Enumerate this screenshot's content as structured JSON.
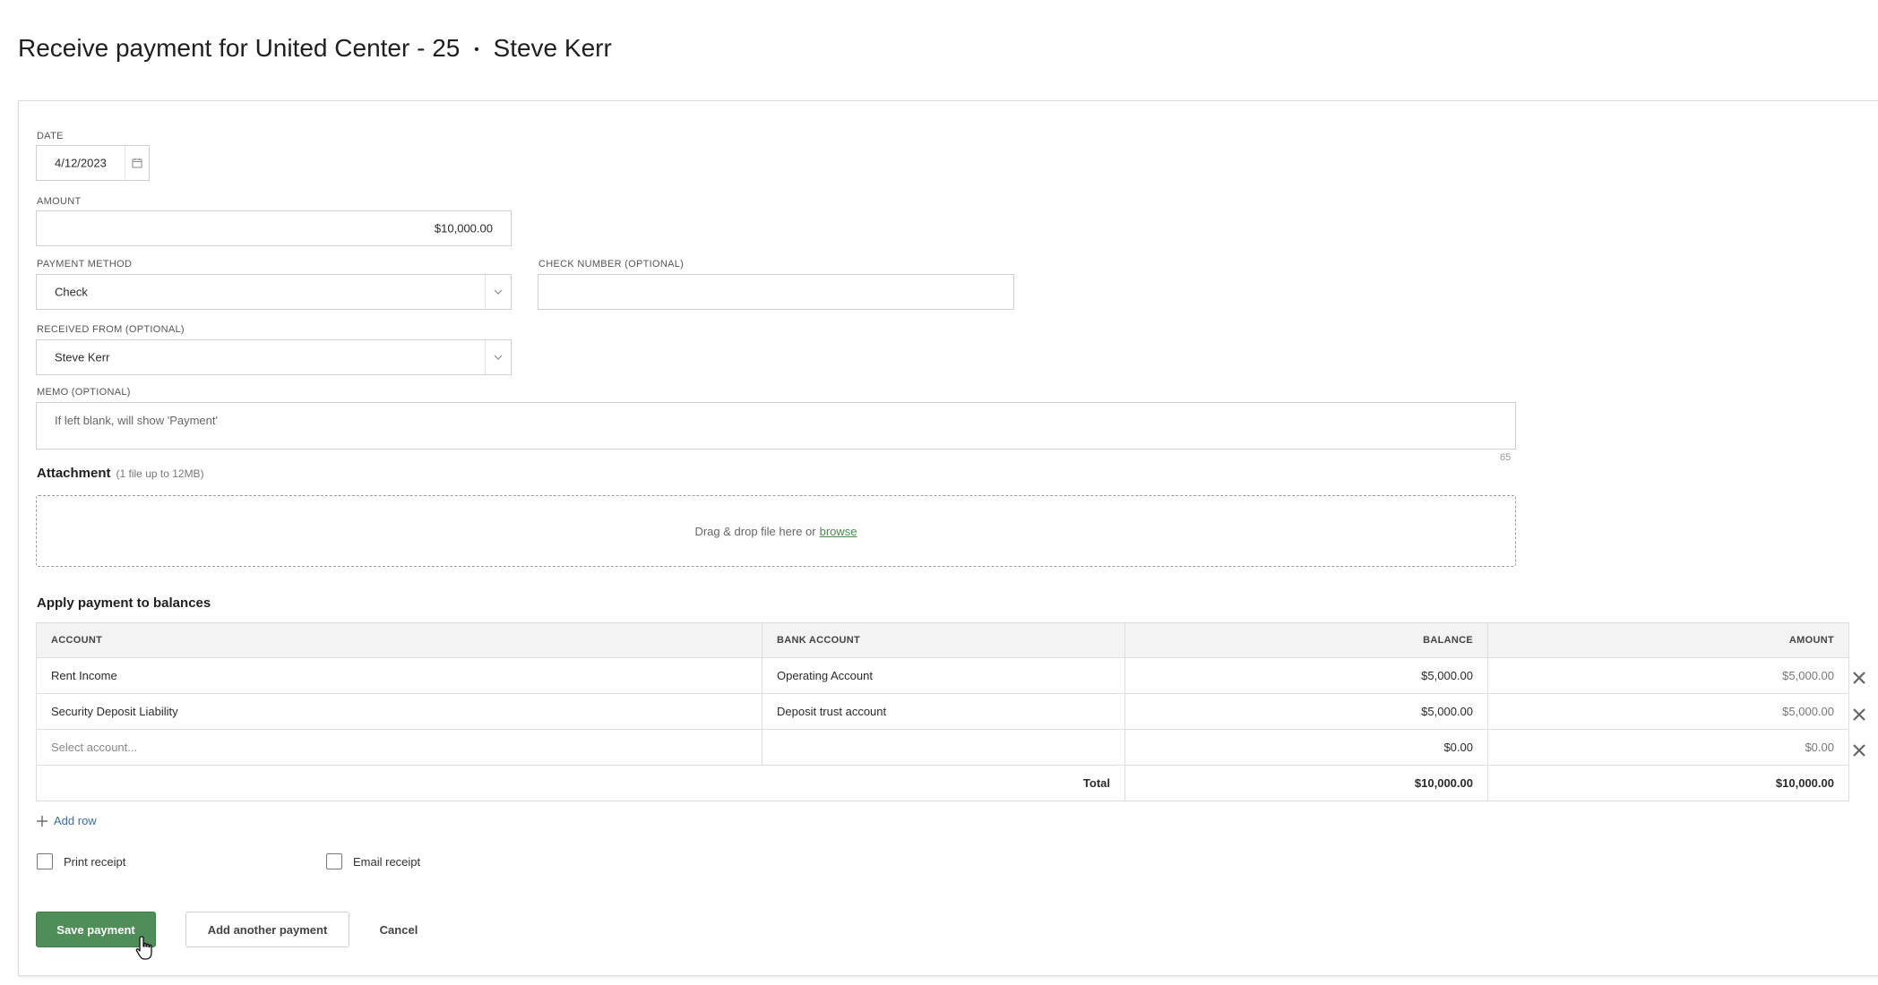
{
  "page": {
    "title": "Receive payment for United Center - 25",
    "separator": "•",
    "tenant": "Steve Kerr"
  },
  "form": {
    "date": {
      "label": "DATE",
      "value": "4/12/2023"
    },
    "amount": {
      "label": "AMOUNT",
      "value": "$10,000.00"
    },
    "payment_method": {
      "label": "PAYMENT METHOD",
      "value": "Check"
    },
    "check_number": {
      "label": "CHECK NUMBER (OPTIONAL)",
      "value": ""
    },
    "received_from": {
      "label": "RECEIVED FROM (OPTIONAL)",
      "value": "Steve Kerr"
    },
    "memo": {
      "label": "MEMO (OPTIONAL)",
      "placeholder": "If left blank, will show 'Payment'",
      "counter": "65"
    }
  },
  "attachment": {
    "title": "Attachment",
    "hint": "(1 file up to 12MB)",
    "drop_text": "Drag & drop file here or",
    "browse_label": "browse"
  },
  "balances": {
    "title": "Apply payment to balances",
    "columns": [
      "ACCOUNT",
      "BANK ACCOUNT",
      "BALANCE",
      "AMOUNT"
    ],
    "rows": [
      {
        "account": "Rent Income",
        "bank_account": "Operating Account",
        "balance": "$5,000.00",
        "amount": "$5,000.00"
      },
      {
        "account": "Security Deposit Liability",
        "bank_account": "Deposit trust account",
        "balance": "$5,000.00",
        "amount": "$5,000.00"
      },
      {
        "account": "Select account...",
        "bank_account": "",
        "balance": "$0.00",
        "amount": "$0.00"
      }
    ],
    "total": {
      "label": "Total",
      "balance": "$10,000.00",
      "amount": "$10,000.00"
    },
    "add_row_label": "Add row"
  },
  "options": {
    "print_receipt": {
      "label": "Print receipt",
      "checked": false
    },
    "email_receipt": {
      "label": "Email receipt",
      "checked": false
    }
  },
  "actions": {
    "save_label": "Save payment",
    "add_another_label": "Add another payment",
    "cancel_label": "Cancel"
  },
  "colors": {
    "primary": "#4f8d59",
    "link": "#3b6fa0",
    "browse_link": "#4a8a4f"
  },
  "icons": {
    "date": "calendar-icon",
    "dropdown": "chevron-down-icon",
    "remove": "close-icon",
    "add": "plus-icon",
    "cursor": "hand-pointer-icon"
  }
}
